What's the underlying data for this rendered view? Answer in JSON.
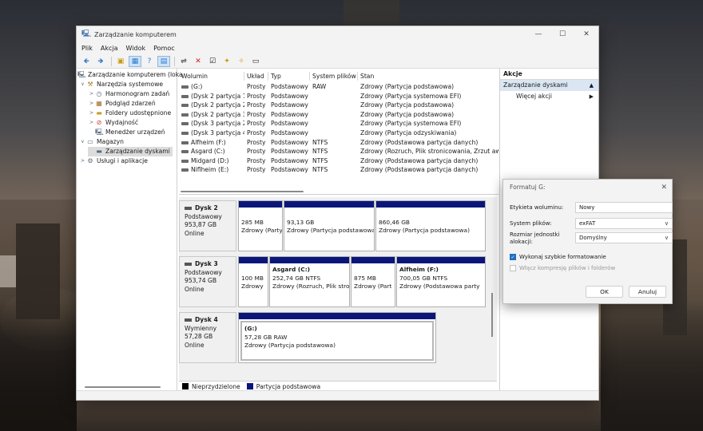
{
  "window": {
    "title": "Zarządzanie komputerem",
    "controls": {
      "minimize": "—",
      "maximize": "☐",
      "close": "✕"
    }
  },
  "menu": [
    "Plik",
    "Akcja",
    "Widok",
    "Pomoc"
  ],
  "toolbar": [
    {
      "icon": "back-arrow-icon",
      "glyph": "🡸"
    },
    {
      "icon": "forward-arrow-icon",
      "glyph": "🡺"
    },
    {
      "icon": "folder-up-icon",
      "glyph": "▣"
    },
    {
      "icon": "show-hide-console-tree-icon",
      "glyph": "▦"
    },
    {
      "icon": "help-icon",
      "glyph": "?"
    },
    {
      "icon": "list-view-icon",
      "glyph": "▤"
    },
    {
      "icon": "connect-icon",
      "glyph": "⇌"
    },
    {
      "icon": "delete-icon",
      "glyph": "✕"
    },
    {
      "icon": "properties-icon",
      "glyph": "☑"
    },
    {
      "icon": "new-icon",
      "glyph": "✦"
    },
    {
      "icon": "wizard-icon",
      "glyph": "✧"
    },
    {
      "icon": "view-icon",
      "glyph": "▭"
    }
  ],
  "tree": [
    {
      "label": "Zarządzanie komputerem (loka",
      "icon": "computer-icon",
      "arrow": "",
      "indent": 0
    },
    {
      "label": "Narzędzia systemowe",
      "icon": "tools-icon",
      "arrow": "∨",
      "indent": 1
    },
    {
      "label": "Harmonogram zadań",
      "icon": "clock-icon",
      "arrow": ">",
      "indent": 2
    },
    {
      "label": "Podgląd zdarzeń",
      "icon": "event-viewer-icon",
      "arrow": ">",
      "indent": 2
    },
    {
      "label": "Foldery udostępnione",
      "icon": "shared-folder-icon",
      "arrow": ">",
      "indent": 2
    },
    {
      "label": "Wydajność",
      "icon": "performance-icon",
      "arrow": ">",
      "indent": 2
    },
    {
      "label": "Menedżer urządzeń",
      "icon": "device-manager-icon",
      "arrow": "",
      "indent": 2
    },
    {
      "label": "Magazyn",
      "icon": "storage-icon",
      "arrow": "∨",
      "indent": 1
    },
    {
      "label": "Zarządzanie dyskami",
      "icon": "disk-management-icon",
      "arrow": "",
      "indent": 2,
      "selected": true
    },
    {
      "label": "Usługi i aplikacje",
      "icon": "services-icon",
      "arrow": ">",
      "indent": 1
    }
  ],
  "volumes": {
    "columns": [
      "Wolumin",
      "Układ",
      "Typ",
      "System plików",
      "Stan"
    ],
    "rows": [
      [
        "(G:)",
        "Prosty",
        "Podstawowy",
        "RAW",
        "Zdrowy (Partycja podstawowa)"
      ],
      [
        "(Dysk 2 partycja 1)",
        "Prosty",
        "Podstawowy",
        "",
        "Zdrowy (Partycja systemowa EFI)"
      ],
      [
        "(Dysk 2 partycja 2)",
        "Prosty",
        "Podstawowy",
        "",
        "Zdrowy (Partycja podstawowa)"
      ],
      [
        "(Dysk 2 partycja 3)",
        "Prosty",
        "Podstawowy",
        "",
        "Zdrowy (Partycja podstawowa)"
      ],
      [
        "(Dysk 3 partycja 2)",
        "Prosty",
        "Podstawowy",
        "",
        "Zdrowy (Partycja systemowa EFI)"
      ],
      [
        "(Dysk 3 partycja 4)",
        "Prosty",
        "Podstawowy",
        "",
        "Zdrowy (Partycja odzyskiwania)"
      ],
      [
        "Alfheim (F:)",
        "Prosty",
        "Podstawowy",
        "NTFS",
        "Zdrowy (Podstawowa partycja danych)"
      ],
      [
        "Asgard (C:)",
        "Prosty",
        "Podstawowy",
        "NTFS",
        "Zdrowy (Rozruch, Plik stronicowania, Zrzut awar"
      ],
      [
        "Midgard (D:)",
        "Prosty",
        "Podstawowy",
        "NTFS",
        "Zdrowy (Podstawowa partycja danych)"
      ],
      [
        "Niflheim (E:)",
        "Prosty",
        "Podstawowy",
        "NTFS",
        "Zdrowy (Podstawowa partycja danych)"
      ]
    ]
  },
  "disks": [
    {
      "name": "Dysk 2",
      "type": "Podstawowy",
      "size": "953,87 GB",
      "status": "Online",
      "partitions": [
        {
          "name": "",
          "size": "285 MB",
          "status": "Zdrowy (Party"
        },
        {
          "name": "",
          "size": "93,13 GB",
          "status": "Zdrowy (Partycja podstawowa"
        },
        {
          "name": "",
          "size": "860,46 GB",
          "status": "Zdrowy (Partycja podstawowa)"
        }
      ]
    },
    {
      "name": "Dysk 3",
      "type": "Podstawowy",
      "size": "953,74 GB",
      "status": "Online",
      "partitions": [
        {
          "name": "",
          "size": "100 MB",
          "status": "Zdrowy"
        },
        {
          "name": "Asgard  (C:)",
          "size": "252,74 GB NTFS",
          "status": "Zdrowy (Rozruch, Plik stro"
        },
        {
          "name": "",
          "size": "875 MB",
          "status": "Zdrowy (Part"
        },
        {
          "name": "Alfheim  (F:)",
          "size": "700,05 GB NTFS",
          "status": "Zdrowy (Podstawowa party"
        }
      ]
    },
    {
      "name": "Dysk 4",
      "type": "Wymienny",
      "size": "57,28 GB",
      "status": "Online",
      "partitions": [
        {
          "name": "(G:)",
          "size": "57,28 GB RAW",
          "status": "Zdrowy (Partycja podstawowa)"
        }
      ]
    }
  ],
  "legend": [
    {
      "label": "Nieprzydzielone",
      "color": "#000000"
    },
    {
      "label": "Partycja podstawowa",
      "color": "#0a167a"
    }
  ],
  "actions": {
    "header": "Akcje",
    "group": "Zarządzanie dyskami",
    "group_arrow": "▲",
    "more": "Więcej akcji",
    "more_arrow": "▶"
  },
  "dialog": {
    "title": "Formatuj G:",
    "close": "✕",
    "label_volume": "Etykieta woluminu:",
    "volume_value": "Nowy",
    "label_fs": "System plików:",
    "fs_value": "exFAT",
    "label_alloc": "Rozmiar jednostki alokacji:",
    "alloc_value": "Domyślny",
    "quick_format": "Wykonaj szybkie formatowanie",
    "compression": "Włącz kompresję plików i folderów",
    "ok": "OK",
    "cancel": "Anuluj",
    "chevron": "∨",
    "check_glyph": "✓"
  }
}
